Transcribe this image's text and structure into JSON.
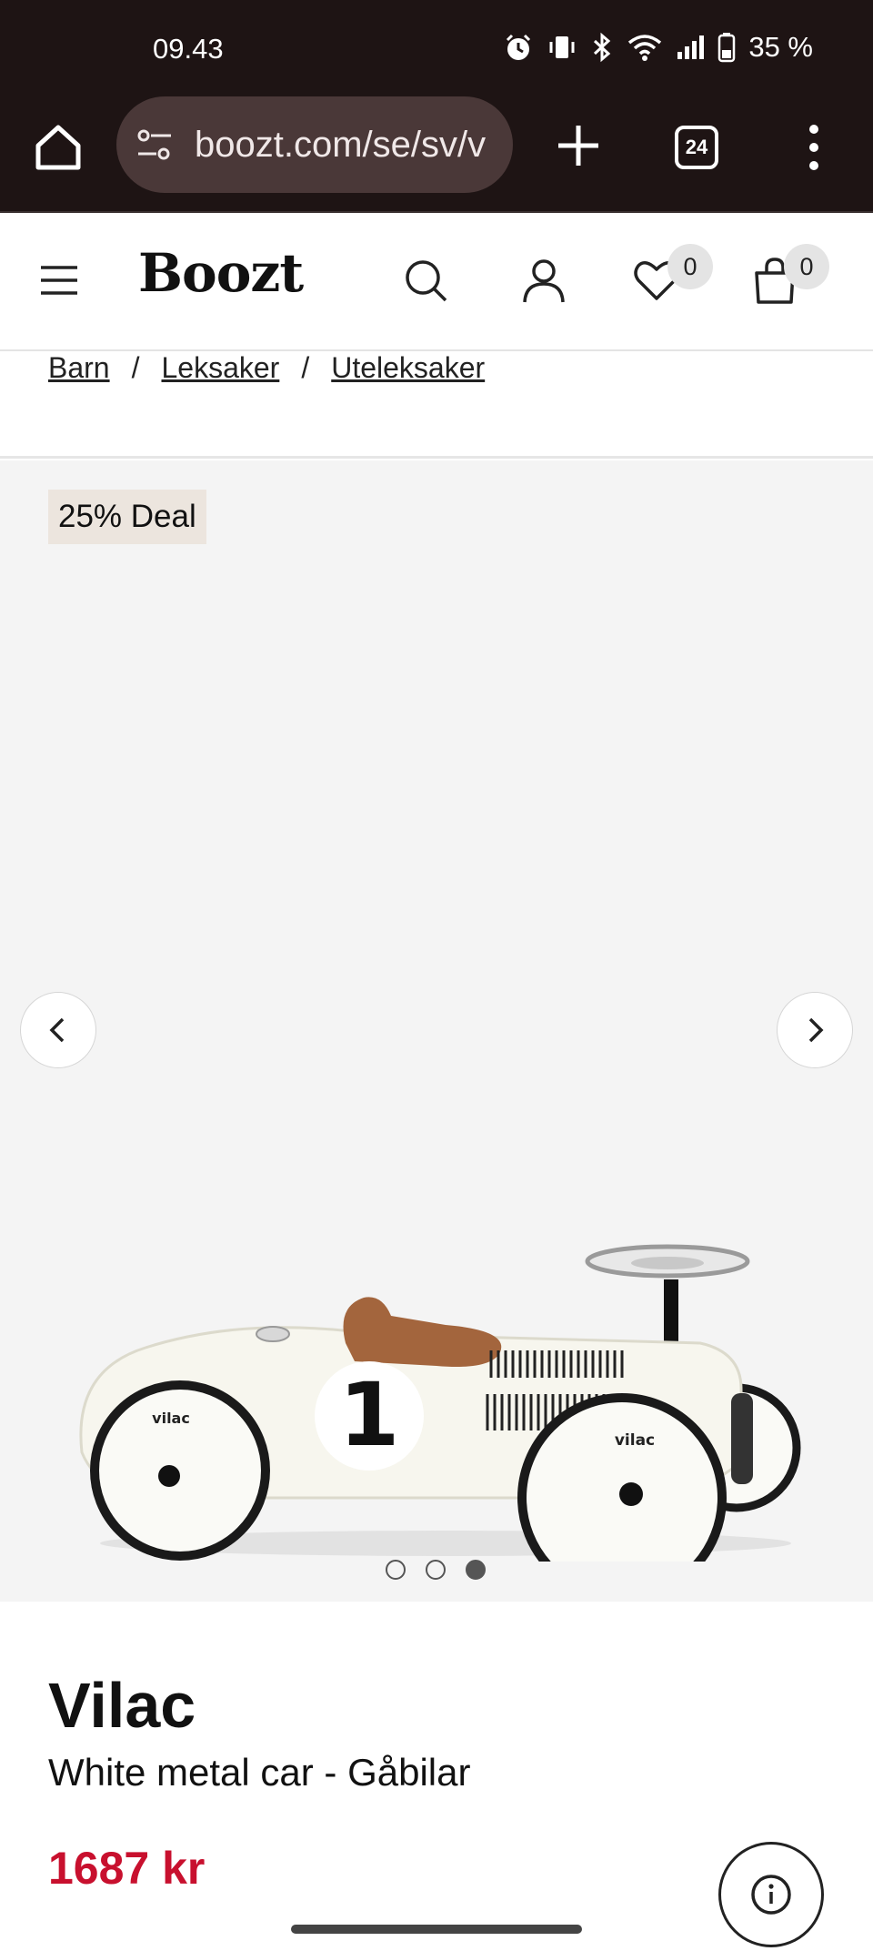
{
  "status_bar": {
    "time": "09.43",
    "battery": "35 %",
    "icons": [
      "alarm-icon",
      "vibrate-icon",
      "bluetooth-icon",
      "wifi-icon",
      "signal-icon",
      "battery-icon"
    ]
  },
  "browser": {
    "url": "boozt.com/se/sv/v",
    "tab_count": "24",
    "icons": [
      "home-icon",
      "site-settings-icon",
      "new-tab-icon",
      "tabs-icon",
      "more-menu-icon"
    ]
  },
  "header": {
    "logo": "Boozt",
    "wishlist_count": "0",
    "cart_count": "0",
    "icons": [
      "hamburger-menu-icon",
      "search-icon",
      "account-icon",
      "heart-icon",
      "bag-icon"
    ]
  },
  "breadcrumb": {
    "items": [
      "Barn",
      "Leksaker",
      "Uteleksaker"
    ],
    "separator": "/"
  },
  "gallery": {
    "deal_label": "25% Deal",
    "image_count": 3,
    "active_index": 2
  },
  "product": {
    "brand": "Vilac",
    "name": "White metal car - Gåbilar",
    "price": "1687 kr",
    "car_number": "1",
    "wheel_brand": "vilac"
  },
  "colors": {
    "browser_chrome": "#1e1414",
    "price_red": "#c8102e",
    "deal_badge_bg": "#ece5de",
    "gallery_bg": "#f4f4f4"
  }
}
